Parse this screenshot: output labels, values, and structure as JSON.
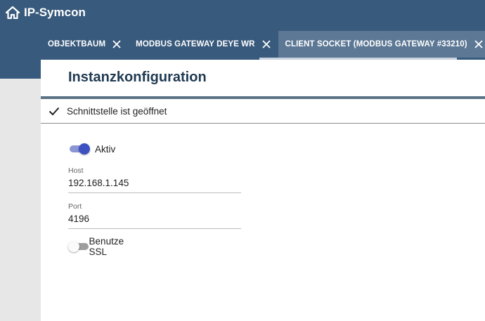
{
  "app": {
    "name": "IP-Symcon",
    "logo_icon": "home-icon",
    "header_color": "#385a7c"
  },
  "tabs": [
    {
      "label": "OBJEKTBAUM",
      "active": false
    },
    {
      "label": "MODBUS GATEWAY DEYE WR",
      "active": false
    },
    {
      "label": "CLIENT SOCKET (MODBUS GATEWAY #33210)",
      "active": true
    }
  ],
  "tab_add_icon": "plus-icon",
  "page": {
    "title": "Instanzkonfiguration"
  },
  "status": {
    "icon": "check-icon",
    "text": "Schnittstelle ist geöffnet"
  },
  "form": {
    "active": {
      "label": "Aktiv",
      "checked": true
    },
    "host": {
      "label": "Host",
      "value": "192.168.1.145"
    },
    "port": {
      "label": "Port",
      "value": "4196"
    },
    "ssl": {
      "label": "Benutze SSL",
      "checked": false
    }
  },
  "colors": {
    "accent": "#3d52c1",
    "tab_active": "#5c7895",
    "title": "#1f3a52"
  }
}
